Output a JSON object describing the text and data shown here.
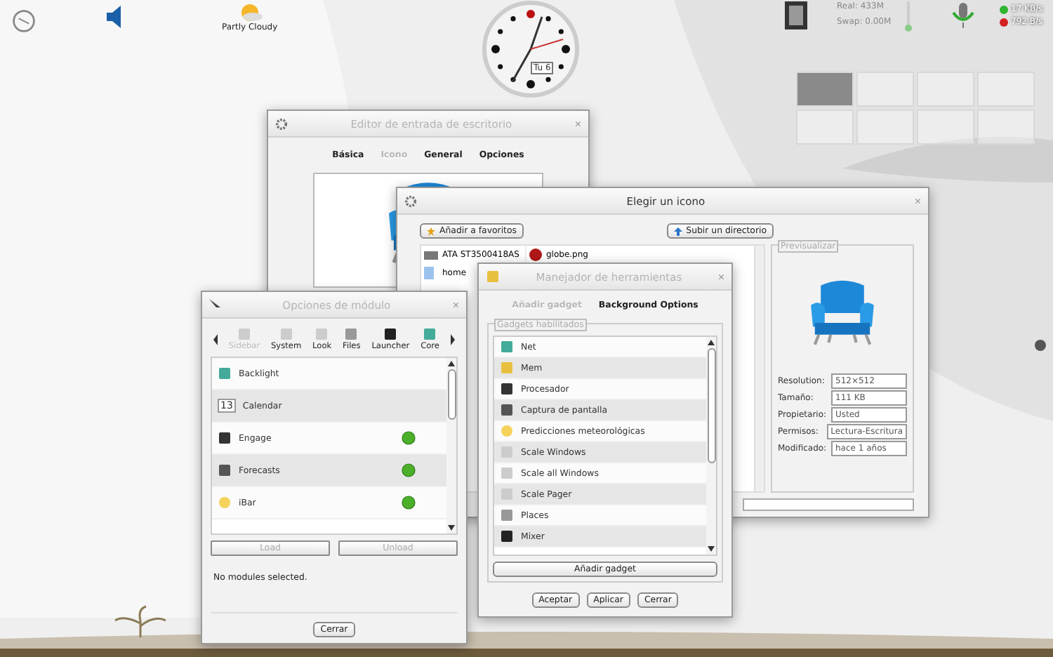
{
  "top_panel": {
    "weather": "Partly Cloudy",
    "clock_date": "Tu 6",
    "memory": [
      "Real: 433M",
      "Swap: 0.00M"
    ],
    "network": [
      {
        "reading": "17 KB/s",
        "color": "#2fb52f"
      },
      {
        "reading": "792 B/s",
        "color": "#d42222"
      }
    ]
  },
  "pager": {
    "desktops": [
      {
        "selected": true
      },
      {
        "selected": false
      },
      {
        "selected": false
      },
      {
        "selected": false
      },
      {
        "selected": false
      },
      {
        "selected": false
      },
      {
        "selected": false
      },
      {
        "selected": false
      }
    ]
  },
  "desktop_entry_editor": {
    "title": "Editor de entrada de escritorio",
    "close": "×",
    "tabs": [
      {
        "label": "Básica",
        "selected": false
      },
      {
        "label": "Icono",
        "selected": true
      },
      {
        "label": "General",
        "selected": false
      },
      {
        "label": "Opciones",
        "selected": false
      }
    ]
  },
  "icon_chooser": {
    "title": "Elegir un icono",
    "close": "×",
    "buttons": [
      "Añadir a favoritos",
      "Subir un directorio"
    ],
    "places": [
      "ATA ST3500418AS",
      "home"
    ],
    "files": [
      "globe.png"
    ],
    "preview": {
      "title": "Previsualizar",
      "fields": [
        {
          "label": "Resolution:",
          "value": "512×512"
        },
        {
          "label": "Tamaño:",
          "value": "111 KB"
        },
        {
          "label": "Propietario:",
          "value": "Usted"
        },
        {
          "label": "Permisos:",
          "value": "Lectura-Escritura"
        },
        {
          "label": "Modificado:",
          "value": "hace 1 años"
        }
      ]
    }
  },
  "module_options": {
    "title": "Opciones de módulo",
    "close": "×",
    "categories": [
      {
        "label": "Sidebar",
        "selected": true
      },
      {
        "label": "System",
        "selected": false
      },
      {
        "label": "Look",
        "selected": false
      },
      {
        "label": "Files",
        "selected": false
      },
      {
        "label": "Launcher",
        "selected": false
      },
      {
        "label": "Core",
        "selected": false
      }
    ],
    "modules": [
      {
        "name": "Backlight",
        "loaded": false
      },
      {
        "name": "Calendar",
        "loaded": false
      },
      {
        "name": "Engage",
        "loaded": true
      },
      {
        "name": "Forecasts",
        "loaded": true
      },
      {
        "name": "iBar",
        "loaded": true
      }
    ],
    "calendar_day": "13",
    "buttons": [
      {
        "label": "Load",
        "disabled": true
      },
      {
        "label": "Unload",
        "disabled": true
      }
    ],
    "status": "No modules selected.",
    "close_button": "Cerrar"
  },
  "gadget_manager": {
    "title": "Manejador de herramientas",
    "close": "×",
    "tabs": [
      {
        "label": "Añadir gadget",
        "selected": true
      },
      {
        "label": "Background Options",
        "selected": false
      }
    ],
    "group_title": "Gadgets habilitados",
    "gadgets": [
      "Net",
      "Mem",
      "Procesador",
      "Captura de pantalla",
      "Predicciones meteorológicas",
      "Scale Windows",
      "Scale all Windows",
      "Scale Pager",
      "Places",
      "Mixer"
    ],
    "add_button": "Añadir gadget",
    "buttons": [
      "Aceptar",
      "Aplicar",
      "Cerrar"
    ]
  }
}
